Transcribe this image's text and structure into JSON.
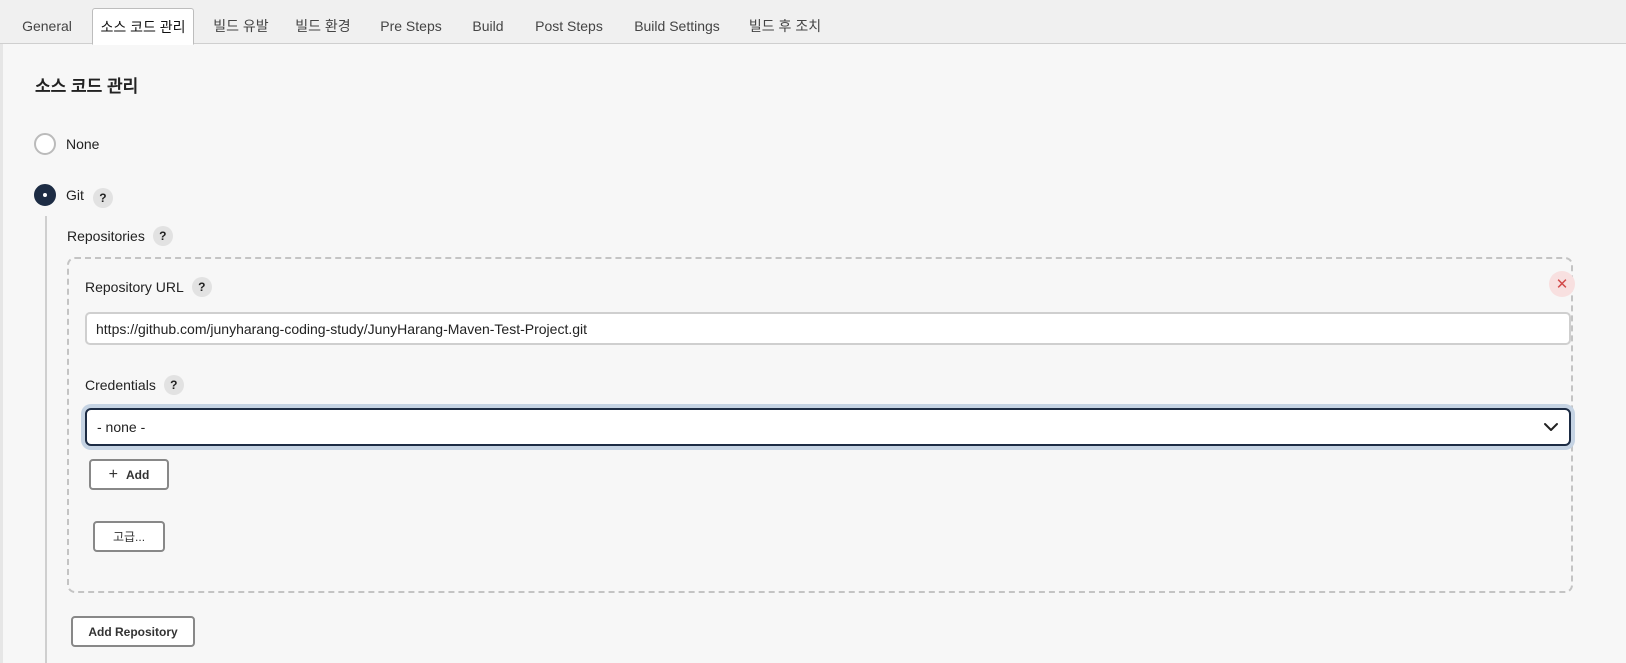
{
  "tabs": [
    {
      "label": "General",
      "active": false
    },
    {
      "label": "소스 코드 관리",
      "active": true
    },
    {
      "label": "빌드 유발",
      "active": false
    },
    {
      "label": "빌드 환경",
      "active": false
    },
    {
      "label": "Pre Steps",
      "active": false
    },
    {
      "label": "Build",
      "active": false
    },
    {
      "label": "Post Steps",
      "active": false
    },
    {
      "label": "Build Settings",
      "active": false
    },
    {
      "label": "빌드 후 조치",
      "active": false
    }
  ],
  "section": {
    "title": "소스 코드 관리",
    "options": {
      "none_label": "None",
      "git_label": "Git",
      "selected": "Git"
    }
  },
  "help_glyph": "?",
  "repositories": {
    "label": "Repositories",
    "repository_url_label": "Repository URL",
    "repository_url_value": "https://github.com/junyharang-coding-study/JunyHarang-Maven-Test-Project.git",
    "credentials_label": "Credentials",
    "credentials_selected": "- none -",
    "add_button": "Add",
    "advanced_button": "고급...",
    "remove_glyph": "✕"
  },
  "add_repository_button": "Add Repository",
  "colors": {
    "accent": "#1d2c44",
    "focus_ring": "#c5d3e3",
    "danger": "#d24b4b"
  }
}
